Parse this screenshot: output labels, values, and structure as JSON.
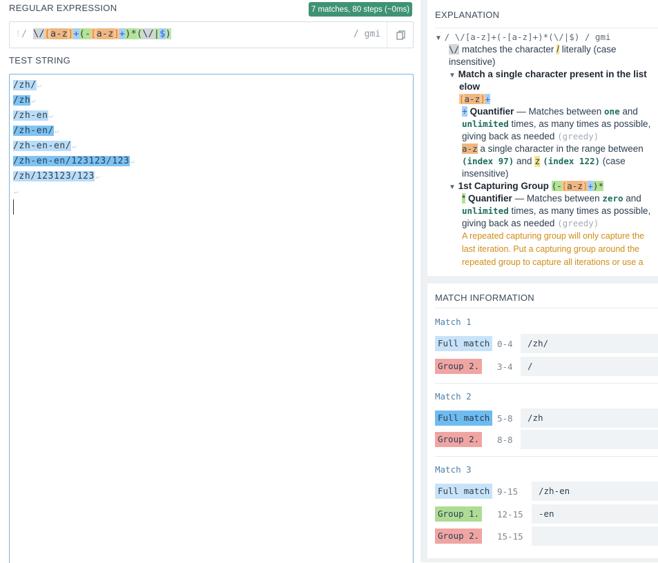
{
  "regex_section": {
    "title": "REGULAR EXPRESSION",
    "badge": "7 matches, 80 steps (~0ms)",
    "delimiter_left": "/",
    "flags": "/ gmi",
    "pattern_parts": [
      "\\/",
      "[",
      "a-z",
      "]",
      "+",
      "(",
      "-",
      "[",
      "a-z",
      "]",
      "+",
      ")",
      "*",
      "(",
      "\\/",
      "|",
      "$",
      ")"
    ]
  },
  "test_section": {
    "title": "TEST STRING",
    "lines": [
      "/zh/",
      "/zh",
      "/zh-en",
      "/zh-en/",
      "/zh-en-en/",
      "/zh-en-en/123123/123",
      "/zh/123123/123",
      ""
    ],
    "eol_marker": "↵"
  },
  "explanation": {
    "title": "EXPLANATION",
    "root_pattern": "/ \\/[a-z]+(-[a-z]+)*(\\/|$) / gmi",
    "esc_token": "\\/",
    "esc_desc_1": "matches the character",
    "esc_char": "/",
    "esc_desc_2": "literally (case",
    "esc_desc_3": "insensitive)",
    "match_list_title_1": "Match a single character present in the list",
    "match_list_title_2": "elow",
    "list_token": "[a-z]+",
    "q1_symbol": "+",
    "q1_label": "Quantifier",
    "q1_text_a": "— Matches between",
    "q1_one": "one",
    "q1_and": "and",
    "q1_unlimited": "unlimited",
    "q1_text_b": "times, as many times as possible,",
    "q1_text_c": "giving back as needed",
    "q1_greedy": "(greedy)",
    "range_token": "a-z",
    "range_text": "a single character in the range between",
    "range_idx_a": "(index 97)",
    "range_and": "and",
    "range_z": "z",
    "range_idx_b": "(index 122)",
    "range_case": "(case",
    "range_insens": "insensitive)",
    "group_title": "1st Capturing Group",
    "group_token": "(-[a-z]+)*",
    "q2_symbol": "*",
    "q2_label": "Quantifier",
    "q2_text_a": "— Matches between",
    "q2_zero": "zero",
    "q2_and": "and",
    "q2_unlimited": "unlimited",
    "q2_text_b": "times, as many times as possible,",
    "q2_text_c": "giving back as needed",
    "q2_greedy": "(greedy)",
    "warn_1": "A repeated capturing group will only capture the",
    "warn_2": "last iteration. Put a capturing group around the",
    "warn_3": "repeated group to capture all iterations or use a"
  },
  "match_info": {
    "title": "MATCH INFORMATION",
    "matches": [
      {
        "header": "Match 1",
        "rows": [
          {
            "tag": "Full match",
            "range": "0-4",
            "value": "/zh/"
          },
          {
            "tag": "Group 2.",
            "range": "3-4",
            "value": "/"
          }
        ]
      },
      {
        "header": "Match 2",
        "rows": [
          {
            "tag": "Full match",
            "range": "5-8",
            "value": "/zh"
          },
          {
            "tag": "Group 2.",
            "range": "8-8",
            "value": ""
          }
        ]
      },
      {
        "header": "Match 3",
        "rows": [
          {
            "tag": "Full match",
            "range": "9-15",
            "value": "/zh-en"
          },
          {
            "tag": "Group 1.",
            "range": "12-15",
            "value": "-en"
          },
          {
            "tag": "Group 2.",
            "range": "15-15",
            "value": ""
          }
        ]
      }
    ]
  },
  "colors": {
    "badge": "#3f9374",
    "full_match_light": "#c8e3f8",
    "full_match_dark": "#6fbbf0",
    "group1": "#aedc95",
    "group2": "#f0a5a3"
  },
  "icons": {
    "copy": "copy-icon",
    "drag": "grip-icon",
    "collapse": "triangle-down-icon"
  }
}
